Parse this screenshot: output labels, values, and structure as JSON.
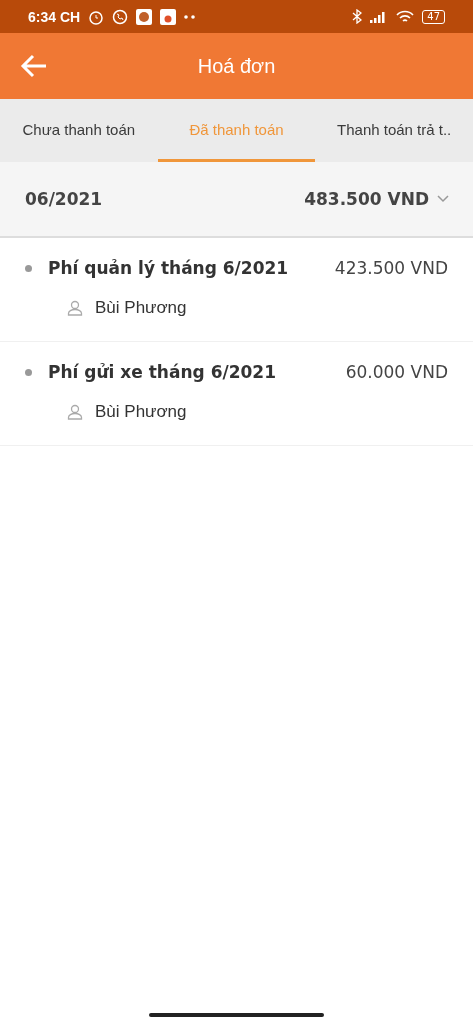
{
  "status_bar": {
    "time": "6:34 CH",
    "battery": "47"
  },
  "header": {
    "title": "Hoá đơn"
  },
  "tabs": [
    {
      "label": "Chưa thanh toán",
      "selected": false
    },
    {
      "label": "Đã thanh toán",
      "selected": true
    },
    {
      "label": "Thanh toán trả t..",
      "selected": false
    }
  ],
  "group": {
    "period": "06/2021",
    "total": "483.500  VND",
    "expanded": true,
    "items": [
      {
        "title": "Phí quản lý tháng 6/2021",
        "amount": "423.500  VND",
        "person": "Bùi Phương"
      },
      {
        "title": "Phí gửi xe tháng 6/2021",
        "amount": "60.000  VND",
        "person": "Bùi Phương"
      }
    ]
  }
}
